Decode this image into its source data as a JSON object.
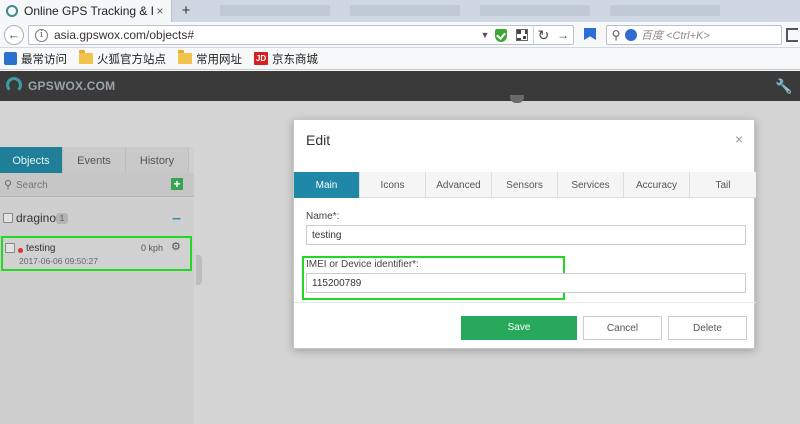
{
  "browser": {
    "tab_title": "Online GPS Tracking & Fle",
    "tab_close": "×",
    "new_tab": "+",
    "url": "asia.gpswox.com/objects#",
    "search_placeholder": "百度 <Ctrl+K>",
    "bookmarks": [
      {
        "label": "最常访问",
        "icon": "bookmark-blue-icon"
      },
      {
        "label": "火狐官方站点",
        "icon": "folder-icon"
      },
      {
        "label": "常用网址",
        "icon": "folder-icon"
      },
      {
        "label": "京东商城",
        "icon": "jd-icon",
        "badge": "JD"
      }
    ]
  },
  "app": {
    "logo_text": "GPSWOX.COM"
  },
  "left_panel": {
    "tabs": [
      {
        "label": "Objects",
        "active": true
      },
      {
        "label": "Events",
        "active": false
      },
      {
        "label": "History",
        "active": false
      }
    ],
    "search_placeholder": "Search",
    "add_label": "+",
    "group": {
      "name": "dragino",
      "count": "1",
      "toggle": "–"
    },
    "device": {
      "name": "testing",
      "time": "2017-06-06 09:50:27",
      "speed": "0 kph"
    }
  },
  "modal": {
    "title": "Edit",
    "close": "×",
    "tabs": [
      {
        "label": "Main",
        "active": true
      },
      {
        "label": "Icons",
        "active": false
      },
      {
        "label": "Advanced",
        "active": false
      },
      {
        "label": "Sensors",
        "active": false
      },
      {
        "label": "Services",
        "active": false
      },
      {
        "label": "Accuracy",
        "active": false
      },
      {
        "label": "Tail",
        "active": false
      }
    ],
    "name_label": "Name*:",
    "name_value": "testing",
    "imei_label": "IMEI or Device identifier*:",
    "imei_value": "115200789",
    "save_label": "Save",
    "cancel_label": "Cancel",
    "delete_label": "Delete"
  },
  "colors": {
    "accent": "#1f87a7",
    "save": "#28a85a",
    "highlight": "#22d822"
  }
}
